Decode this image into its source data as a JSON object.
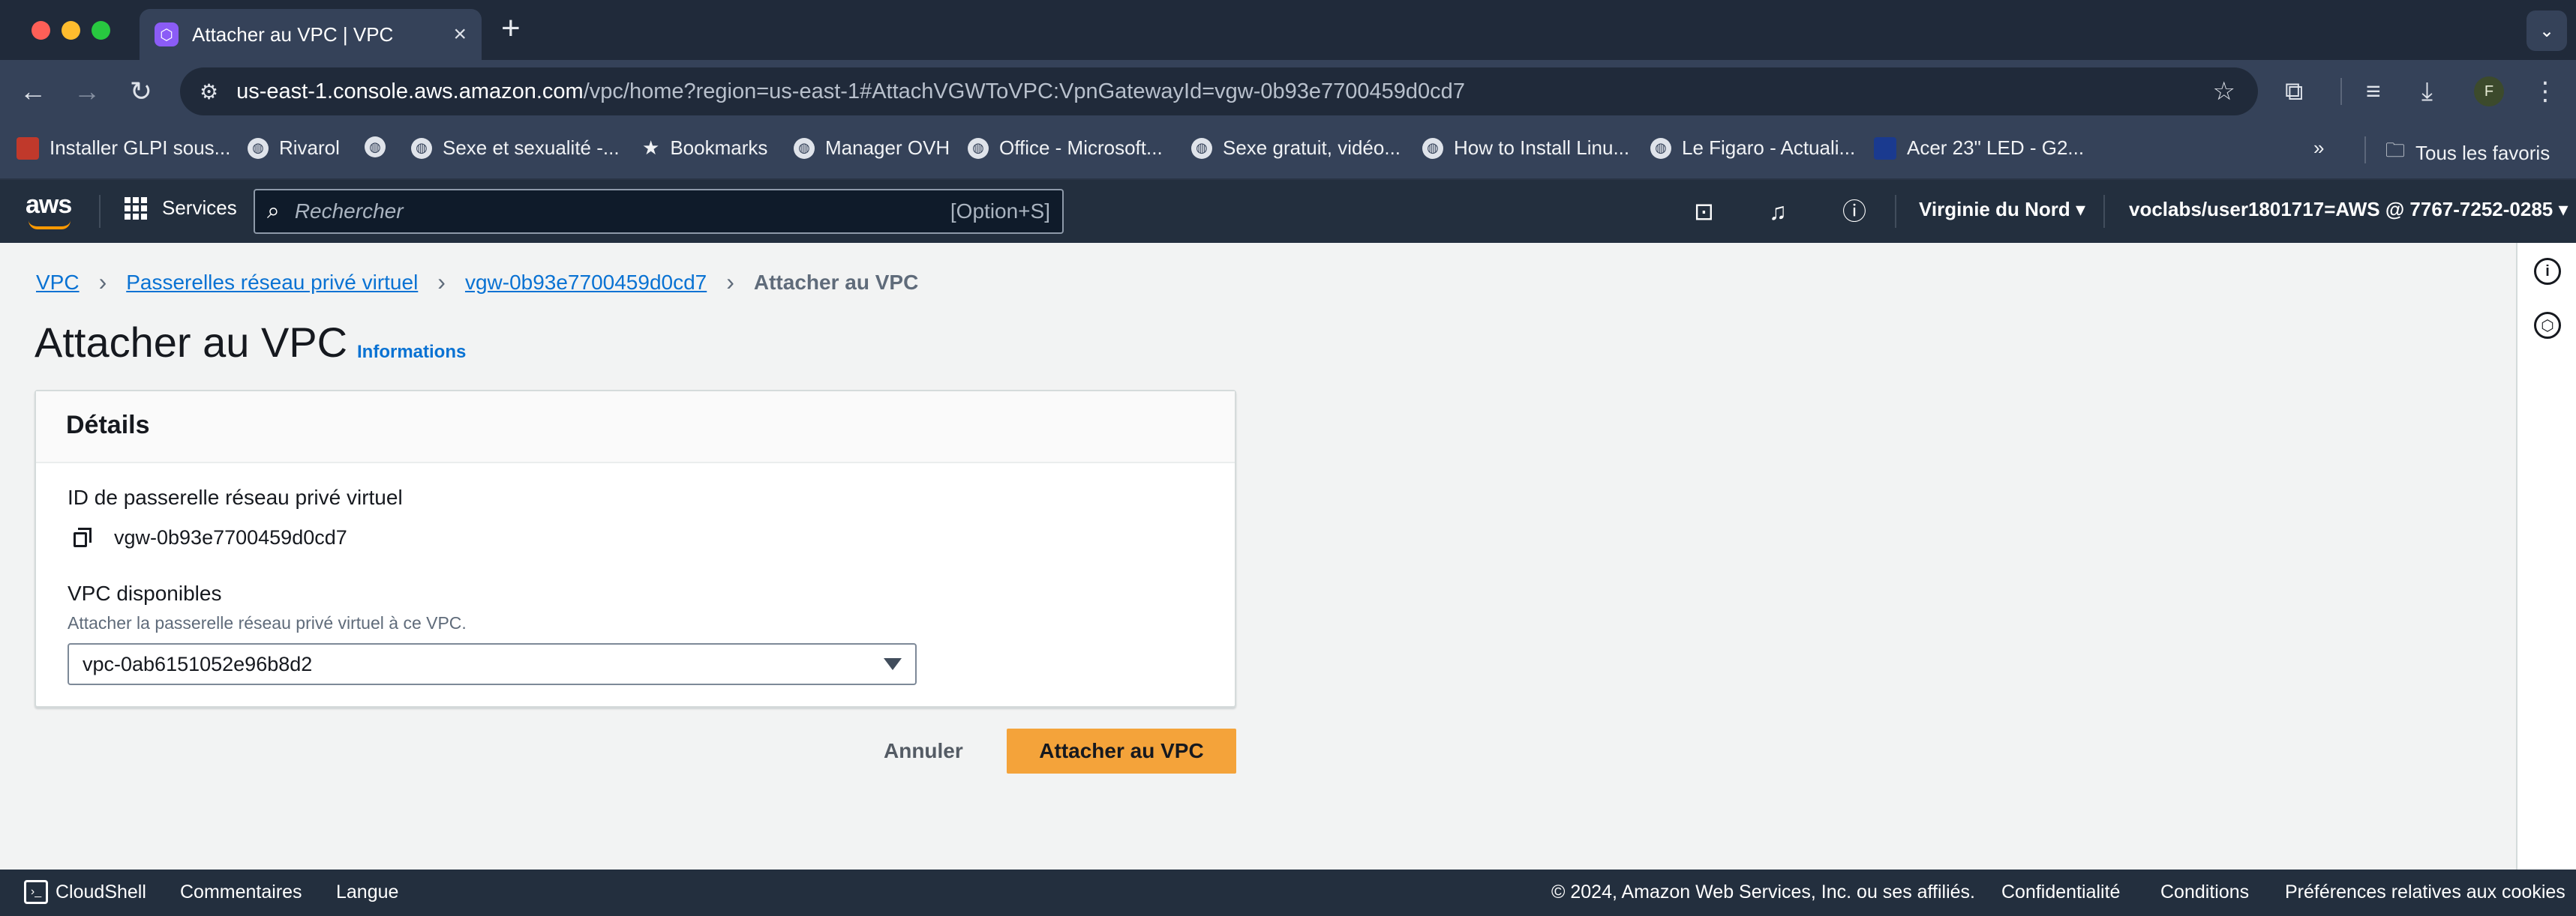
{
  "browser": {
    "tab": {
      "title": "Attacher au VPC | VPC",
      "favicon": "vpc-favicon"
    },
    "url_host": "us-east-1.console.aws.amazon.com",
    "url_rest": "/vpc/home?region=us-east-1#AttachVGWToVPC:VpnGatewayId=vgw-0b93e7700459d0cd7",
    "profile_initial": "F",
    "bookmarks": [
      {
        "label": "Installer GLPI sous..."
      },
      {
        "label": "Rivarol"
      },
      {
        "label": ""
      },
      {
        "label": "Sexe et sexualité -..."
      },
      {
        "label": "Bookmarks"
      },
      {
        "label": "Manager OVH"
      },
      {
        "label": "Office - Microsoft..."
      },
      {
        "label": "Sexe gratuit, vidéo..."
      },
      {
        "label": "How to Install Linu..."
      },
      {
        "label": "Le Figaro - Actuali..."
      },
      {
        "label": "Acer 23\" LED - G2..."
      }
    ],
    "all_bookmarks": "Tous les favoris"
  },
  "aws_nav": {
    "logo": "aws",
    "services": "Services",
    "search_placeholder": "Rechercher",
    "search_shortcut": "[Option+S]",
    "region": "Virginie du Nord",
    "account": "voclabs/user1801717=AWS @ 7767-7252-0285"
  },
  "breadcrumb": {
    "items": [
      "VPC",
      "Passerelles réseau privé virtuel",
      "vgw-0b93e7700459d0cd7"
    ],
    "current": "Attacher au VPC"
  },
  "page": {
    "title": "Attacher au VPC",
    "info": "Informations"
  },
  "details": {
    "header": "Détails",
    "gateway_label": "ID de passerelle réseau privé virtuel",
    "gateway_value": "vgw-0b93e7700459d0cd7",
    "vpc_label": "VPC disponibles",
    "vpc_description": "Attacher la passerelle réseau privé virtuel à ce VPC.",
    "vpc_selected": "vpc-0ab6151052e96b8d2"
  },
  "actions": {
    "cancel": "Annuler",
    "submit": "Attacher au VPC"
  },
  "footer": {
    "cloudshell": "CloudShell",
    "feedback": "Commentaires",
    "language": "Langue",
    "copyright": "© 2024, Amazon Web Services, Inc. ou ses affiliés.",
    "privacy": "Confidentialité",
    "terms": "Conditions",
    "cookies": "Préférences relatives aux cookies"
  },
  "colors": {
    "primary_button": "#f4a33a",
    "link": "#0972d3",
    "aws_nav_bg": "#232f3e",
    "browser_bg": "#354259"
  }
}
